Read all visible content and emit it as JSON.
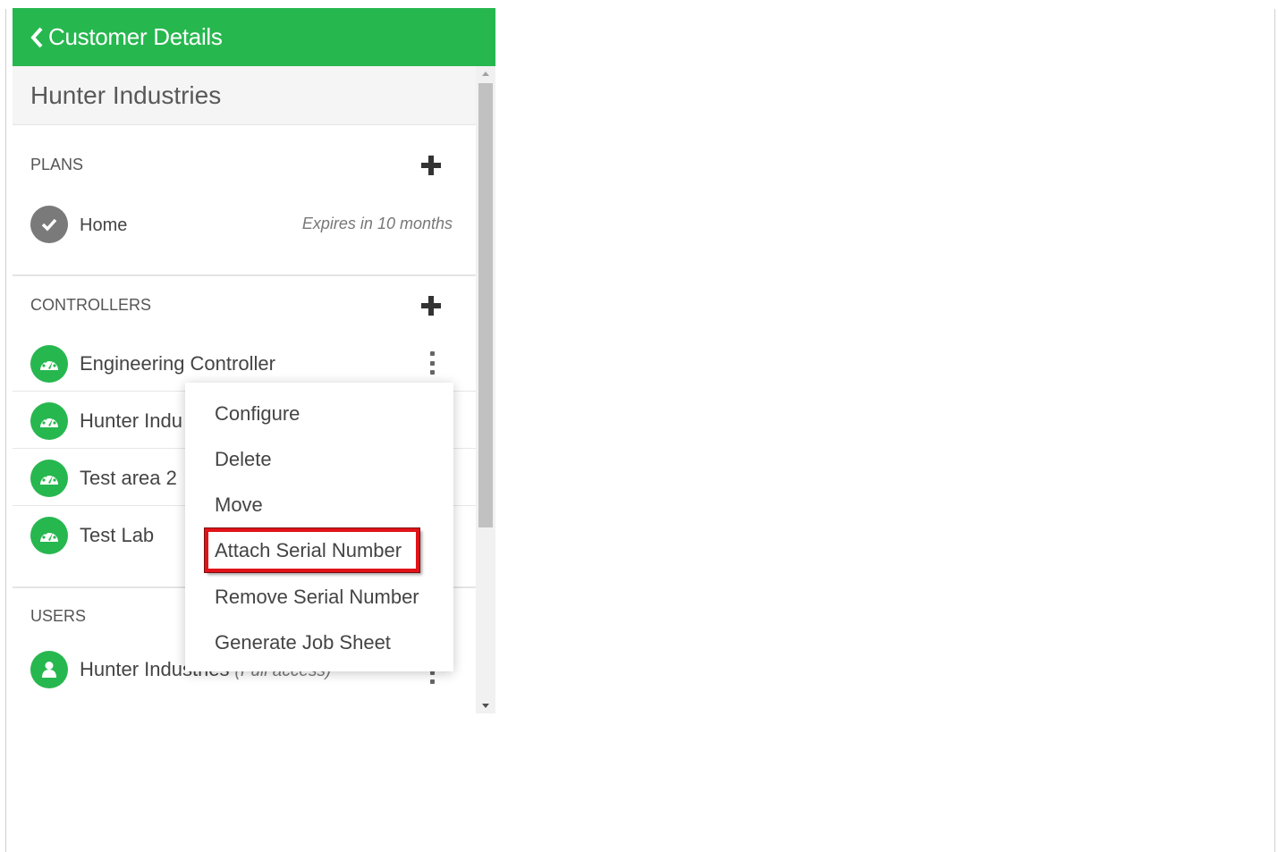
{
  "header": {
    "title": "Customer Details"
  },
  "customer": {
    "name": "Hunter Industries"
  },
  "plans": {
    "label": "PLANS",
    "items": [
      {
        "name": "Home",
        "expiry": "Expires in 10 months"
      }
    ]
  },
  "controllers": {
    "label": "CONTROLLERS",
    "items": [
      {
        "name": "Engineering Controller"
      },
      {
        "name": "Hunter Indu"
      },
      {
        "name": "Test area 2"
      },
      {
        "name": "Test Lab"
      }
    ]
  },
  "users": {
    "label": "USERS",
    "items": [
      {
        "name": "Hunter Industries",
        "access": "(Full access)"
      }
    ]
  },
  "context_menu": {
    "items": [
      "Configure",
      "Delete",
      "Move",
      "Attach Serial Number",
      "Remove Serial Number",
      "Generate Job Sheet"
    ],
    "highlighted": "Attach Serial Number"
  },
  "colors": {
    "brand_green": "#27b74f",
    "highlight_red": "#e11318"
  },
  "icons": {
    "back": "chevron-left-icon",
    "add": "plus-icon",
    "plan": "check-circle-icon",
    "controller": "gauge-icon",
    "user": "user-icon",
    "more": "kebab-icon"
  }
}
